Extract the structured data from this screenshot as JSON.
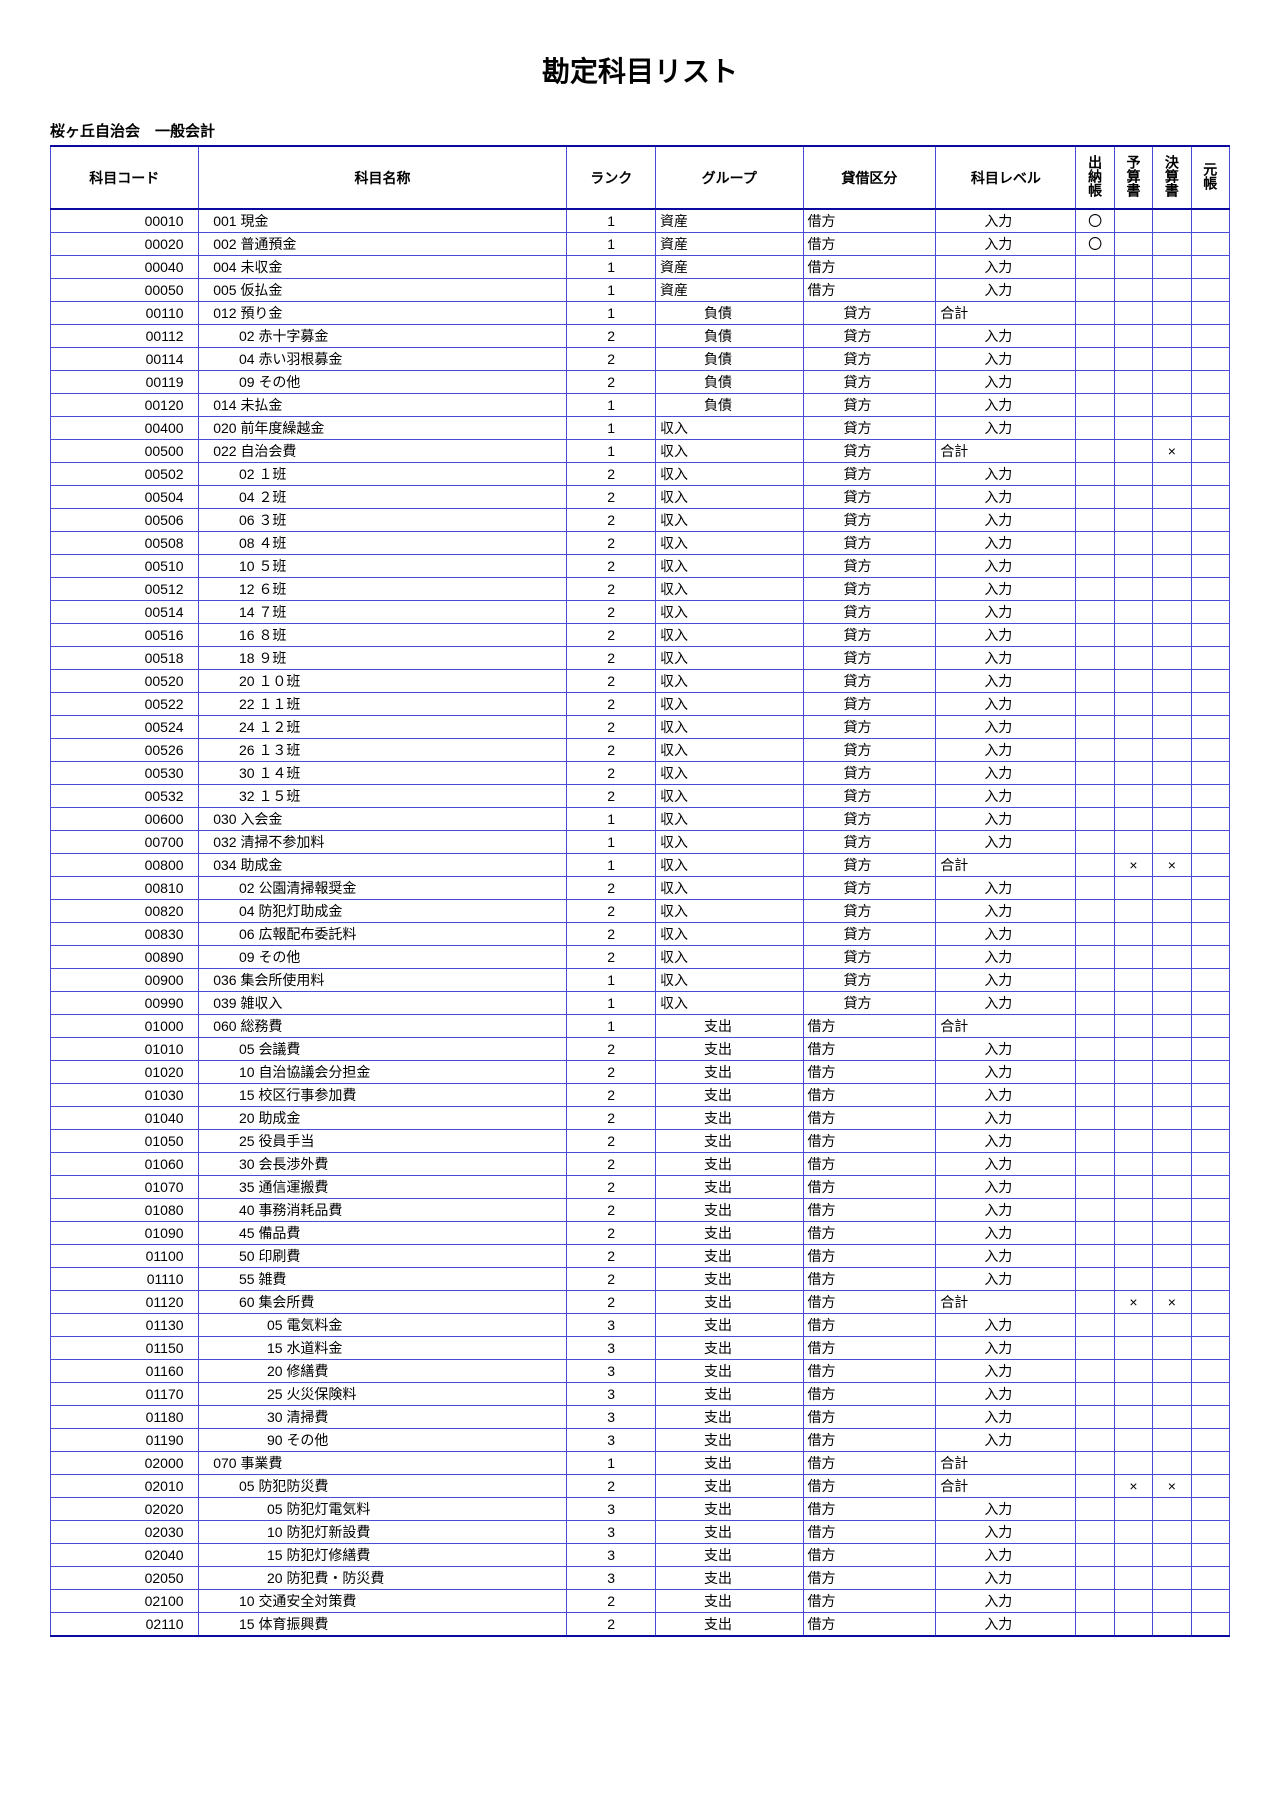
{
  "title": "勘定科目リスト",
  "org": "桜ヶ丘自治会　一般会計",
  "headers": {
    "code": "科目コード",
    "name": "科目名称",
    "rank": "ランク",
    "group": "グループ",
    "drcr": "貸借区分",
    "level": "科目レベル",
    "cashbook": "出納帳",
    "budget": "予算書",
    "settlement": "決算書",
    "ledger": "元帳"
  },
  "rows": [
    {
      "code": "00010",
      "num": "001",
      "name": "現金",
      "ind": 0,
      "rank": "1",
      "group": "資産",
      "galign": "l",
      "drcr": "借方",
      "level": "入力",
      "lalign": "r",
      "cb": "〇"
    },
    {
      "code": "00020",
      "num": "002",
      "name": "普通預金",
      "ind": 0,
      "rank": "1",
      "group": "資産",
      "galign": "l",
      "drcr": "借方",
      "level": "入力",
      "lalign": "r",
      "cb": "〇"
    },
    {
      "code": "00040",
      "num": "004",
      "name": "未収金",
      "ind": 0,
      "rank": "1",
      "group": "資産",
      "galign": "l",
      "drcr": "借方",
      "level": "入力",
      "lalign": "r"
    },
    {
      "code": "00050",
      "num": "005",
      "name": "仮払金",
      "ind": 0,
      "rank": "1",
      "group": "資産",
      "galign": "l",
      "drcr": "借方",
      "level": "入力",
      "lalign": "r"
    },
    {
      "code": "00110",
      "num": "012",
      "name": "預り金",
      "ind": 0,
      "rank": "1",
      "group": "負債",
      "galign": "r",
      "drcr": "貸方",
      "dalign": "r",
      "level": "合計",
      "lalign": "l"
    },
    {
      "code": "00112",
      "num": "02",
      "name": "赤十字募金",
      "ind": 1,
      "rank": "2",
      "group": "負債",
      "galign": "r",
      "drcr": "貸方",
      "dalign": "r",
      "level": "入力",
      "lalign": "r"
    },
    {
      "code": "00114",
      "num": "04",
      "name": "赤い羽根募金",
      "ind": 1,
      "rank": "2",
      "group": "負債",
      "galign": "r",
      "drcr": "貸方",
      "dalign": "r",
      "level": "入力",
      "lalign": "r"
    },
    {
      "code": "00119",
      "num": "09",
      "name": "その他",
      "ind": 1,
      "rank": "2",
      "group": "負債",
      "galign": "r",
      "drcr": "貸方",
      "dalign": "r",
      "level": "入力",
      "lalign": "r"
    },
    {
      "code": "00120",
      "num": "014",
      "name": "未払金",
      "ind": 0,
      "rank": "1",
      "group": "負債",
      "galign": "r",
      "drcr": "貸方",
      "dalign": "r",
      "level": "入力",
      "lalign": "r"
    },
    {
      "code": "00400",
      "num": "020",
      "name": "前年度繰越金",
      "ind": 0,
      "rank": "1",
      "group": "収入",
      "galign": "l",
      "drcr": "貸方",
      "dalign": "r",
      "level": "入力",
      "lalign": "r"
    },
    {
      "code": "00500",
      "num": "022",
      "name": "自治会費",
      "ind": 0,
      "rank": "1",
      "group": "収入",
      "galign": "l",
      "drcr": "貸方",
      "dalign": "r",
      "level": "合計",
      "lalign": "l",
      "st": "×"
    },
    {
      "code": "00502",
      "num": "02",
      "name": "１班",
      "ind": 1,
      "rank": "2",
      "group": "収入",
      "galign": "l",
      "drcr": "貸方",
      "dalign": "r",
      "level": "入力",
      "lalign": "r"
    },
    {
      "code": "00504",
      "num": "04",
      "name": "２班",
      "ind": 1,
      "rank": "2",
      "group": "収入",
      "galign": "l",
      "drcr": "貸方",
      "dalign": "r",
      "level": "入力",
      "lalign": "r"
    },
    {
      "code": "00506",
      "num": "06",
      "name": "３班",
      "ind": 1,
      "rank": "2",
      "group": "収入",
      "galign": "l",
      "drcr": "貸方",
      "dalign": "r",
      "level": "入力",
      "lalign": "r"
    },
    {
      "code": "00508",
      "num": "08",
      "name": "４班",
      "ind": 1,
      "rank": "2",
      "group": "収入",
      "galign": "l",
      "drcr": "貸方",
      "dalign": "r",
      "level": "入力",
      "lalign": "r"
    },
    {
      "code": "00510",
      "num": "10",
      "name": "５班",
      "ind": 1,
      "rank": "2",
      "group": "収入",
      "galign": "l",
      "drcr": "貸方",
      "dalign": "r",
      "level": "入力",
      "lalign": "r"
    },
    {
      "code": "00512",
      "num": "12",
      "name": "６班",
      "ind": 1,
      "rank": "2",
      "group": "収入",
      "galign": "l",
      "drcr": "貸方",
      "dalign": "r",
      "level": "入力",
      "lalign": "r"
    },
    {
      "code": "00514",
      "num": "14",
      "name": "７班",
      "ind": 1,
      "rank": "2",
      "group": "収入",
      "galign": "l",
      "drcr": "貸方",
      "dalign": "r",
      "level": "入力",
      "lalign": "r"
    },
    {
      "code": "00516",
      "num": "16",
      "name": "８班",
      "ind": 1,
      "rank": "2",
      "group": "収入",
      "galign": "l",
      "drcr": "貸方",
      "dalign": "r",
      "level": "入力",
      "lalign": "r"
    },
    {
      "code": "00518",
      "num": "18",
      "name": "９班",
      "ind": 1,
      "rank": "2",
      "group": "収入",
      "galign": "l",
      "drcr": "貸方",
      "dalign": "r",
      "level": "入力",
      "lalign": "r"
    },
    {
      "code": "00520",
      "num": "20",
      "name": "１０班",
      "ind": 1,
      "rank": "2",
      "group": "収入",
      "galign": "l",
      "drcr": "貸方",
      "dalign": "r",
      "level": "入力",
      "lalign": "r"
    },
    {
      "code": "00522",
      "num": "22",
      "name": "１１班",
      "ind": 1,
      "rank": "2",
      "group": "収入",
      "galign": "l",
      "drcr": "貸方",
      "dalign": "r",
      "level": "入力",
      "lalign": "r"
    },
    {
      "code": "00524",
      "num": "24",
      "name": "１２班",
      "ind": 1,
      "rank": "2",
      "group": "収入",
      "galign": "l",
      "drcr": "貸方",
      "dalign": "r",
      "level": "入力",
      "lalign": "r"
    },
    {
      "code": "00526",
      "num": "26",
      "name": "１３班",
      "ind": 1,
      "rank": "2",
      "group": "収入",
      "galign": "l",
      "drcr": "貸方",
      "dalign": "r",
      "level": "入力",
      "lalign": "r"
    },
    {
      "code": "00530",
      "num": "30",
      "name": "１４班",
      "ind": 1,
      "rank": "2",
      "group": "収入",
      "galign": "l",
      "drcr": "貸方",
      "dalign": "r",
      "level": "入力",
      "lalign": "r"
    },
    {
      "code": "00532",
      "num": "32",
      "name": "１５班",
      "ind": 1,
      "rank": "2",
      "group": "収入",
      "galign": "l",
      "drcr": "貸方",
      "dalign": "r",
      "level": "入力",
      "lalign": "r"
    },
    {
      "code": "00600",
      "num": "030",
      "name": "入会金",
      "ind": 0,
      "rank": "1",
      "group": "収入",
      "galign": "l",
      "drcr": "貸方",
      "dalign": "r",
      "level": "入力",
      "lalign": "r"
    },
    {
      "code": "00700",
      "num": "032",
      "name": "清掃不参加料",
      "ind": 0,
      "rank": "1",
      "group": "収入",
      "galign": "l",
      "drcr": "貸方",
      "dalign": "r",
      "level": "入力",
      "lalign": "r"
    },
    {
      "code": "00800",
      "num": "034",
      "name": "助成金",
      "ind": 0,
      "rank": "1",
      "group": "収入",
      "galign": "l",
      "drcr": "貸方",
      "dalign": "r",
      "level": "合計",
      "lalign": "l",
      "bd": "×",
      "st": "×"
    },
    {
      "code": "00810",
      "num": "02",
      "name": "公園清掃報奨金",
      "ind": 1,
      "rank": "2",
      "group": "収入",
      "galign": "l",
      "drcr": "貸方",
      "dalign": "r",
      "level": "入力",
      "lalign": "r"
    },
    {
      "code": "00820",
      "num": "04",
      "name": "防犯灯助成金",
      "ind": 1,
      "rank": "2",
      "group": "収入",
      "galign": "l",
      "drcr": "貸方",
      "dalign": "r",
      "level": "入力",
      "lalign": "r"
    },
    {
      "code": "00830",
      "num": "06",
      "name": "広報配布委託料",
      "ind": 1,
      "rank": "2",
      "group": "収入",
      "galign": "l",
      "drcr": "貸方",
      "dalign": "r",
      "level": "入力",
      "lalign": "r"
    },
    {
      "code": "00890",
      "num": "09",
      "name": "その他",
      "ind": 1,
      "rank": "2",
      "group": "収入",
      "galign": "l",
      "drcr": "貸方",
      "dalign": "r",
      "level": "入力",
      "lalign": "r"
    },
    {
      "code": "00900",
      "num": "036",
      "name": "集会所使用料",
      "ind": 0,
      "rank": "1",
      "group": "収入",
      "galign": "l",
      "drcr": "貸方",
      "dalign": "r",
      "level": "入力",
      "lalign": "r"
    },
    {
      "code": "00990",
      "num": "039",
      "name": "雑収入",
      "ind": 0,
      "rank": "1",
      "group": "収入",
      "galign": "l",
      "drcr": "貸方",
      "dalign": "r",
      "level": "入力",
      "lalign": "r"
    },
    {
      "code": "01000",
      "num": "060",
      "name": "総務費",
      "ind": 0,
      "rank": "1",
      "group": "支出",
      "galign": "r",
      "drcr": "借方",
      "level": "合計",
      "lalign": "l"
    },
    {
      "code": "01010",
      "num": "05",
      "name": "会議費",
      "ind": 1,
      "rank": "2",
      "group": "支出",
      "galign": "r",
      "drcr": "借方",
      "level": "入力",
      "lalign": "r"
    },
    {
      "code": "01020",
      "num": "10",
      "name": "自治協議会分担金",
      "ind": 1,
      "rank": "2",
      "group": "支出",
      "galign": "r",
      "drcr": "借方",
      "level": "入力",
      "lalign": "r"
    },
    {
      "code": "01030",
      "num": "15",
      "name": "校区行事参加費",
      "ind": 1,
      "rank": "2",
      "group": "支出",
      "galign": "r",
      "drcr": "借方",
      "level": "入力",
      "lalign": "r"
    },
    {
      "code": "01040",
      "num": "20",
      "name": "助成金",
      "ind": 1,
      "rank": "2",
      "group": "支出",
      "galign": "r",
      "drcr": "借方",
      "level": "入力",
      "lalign": "r"
    },
    {
      "code": "01050",
      "num": "25",
      "name": "役員手当",
      "ind": 1,
      "rank": "2",
      "group": "支出",
      "galign": "r",
      "drcr": "借方",
      "level": "入力",
      "lalign": "r"
    },
    {
      "code": "01060",
      "num": "30",
      "name": "会長渉外費",
      "ind": 1,
      "rank": "2",
      "group": "支出",
      "galign": "r",
      "drcr": "借方",
      "level": "入力",
      "lalign": "r"
    },
    {
      "code": "01070",
      "num": "35",
      "name": "通信運搬費",
      "ind": 1,
      "rank": "2",
      "group": "支出",
      "galign": "r",
      "drcr": "借方",
      "level": "入力",
      "lalign": "r"
    },
    {
      "code": "01080",
      "num": "40",
      "name": "事務消耗品費",
      "ind": 1,
      "rank": "2",
      "group": "支出",
      "galign": "r",
      "drcr": "借方",
      "level": "入力",
      "lalign": "r"
    },
    {
      "code": "01090",
      "num": "45",
      "name": "備品費",
      "ind": 1,
      "rank": "2",
      "group": "支出",
      "galign": "r",
      "drcr": "借方",
      "level": "入力",
      "lalign": "r"
    },
    {
      "code": "01100",
      "num": "50",
      "name": "印刷費",
      "ind": 1,
      "rank": "2",
      "group": "支出",
      "galign": "r",
      "drcr": "借方",
      "level": "入力",
      "lalign": "r"
    },
    {
      "code": "01110",
      "num": "55",
      "name": "雑費",
      "ind": 1,
      "rank": "2",
      "group": "支出",
      "galign": "r",
      "drcr": "借方",
      "level": "入力",
      "lalign": "r"
    },
    {
      "code": "01120",
      "num": "60",
      "name": "集会所費",
      "ind": 1,
      "rank": "2",
      "group": "支出",
      "galign": "r",
      "drcr": "借方",
      "level": "合計",
      "lalign": "l",
      "bd": "×",
      "st": "×"
    },
    {
      "code": "01130",
      "num": "05",
      "name": "電気料金",
      "ind": 2,
      "rank": "3",
      "group": "支出",
      "galign": "r",
      "drcr": "借方",
      "level": "入力",
      "lalign": "r"
    },
    {
      "code": "01150",
      "num": "15",
      "name": "水道料金",
      "ind": 2,
      "rank": "3",
      "group": "支出",
      "galign": "r",
      "drcr": "借方",
      "level": "入力",
      "lalign": "r"
    },
    {
      "code": "01160",
      "num": "20",
      "name": "修繕費",
      "ind": 2,
      "rank": "3",
      "group": "支出",
      "galign": "r",
      "drcr": "借方",
      "level": "入力",
      "lalign": "r"
    },
    {
      "code": "01170",
      "num": "25",
      "name": "火災保険料",
      "ind": 2,
      "rank": "3",
      "group": "支出",
      "galign": "r",
      "drcr": "借方",
      "level": "入力",
      "lalign": "r"
    },
    {
      "code": "01180",
      "num": "30",
      "name": "清掃費",
      "ind": 2,
      "rank": "3",
      "group": "支出",
      "galign": "r",
      "drcr": "借方",
      "level": "入力",
      "lalign": "r"
    },
    {
      "code": "01190",
      "num": "90",
      "name": "その他",
      "ind": 2,
      "rank": "3",
      "group": "支出",
      "galign": "r",
      "drcr": "借方",
      "level": "入力",
      "lalign": "r"
    },
    {
      "code": "02000",
      "num": "070",
      "name": "事業費",
      "ind": 0,
      "rank": "1",
      "group": "支出",
      "galign": "r",
      "drcr": "借方",
      "level": "合計",
      "lalign": "l"
    },
    {
      "code": "02010",
      "num": "05",
      "name": "防犯防災費",
      "ind": 1,
      "rank": "2",
      "group": "支出",
      "galign": "r",
      "drcr": "借方",
      "level": "合計",
      "lalign": "l",
      "bd": "×",
      "st": "×"
    },
    {
      "code": "02020",
      "num": "05",
      "name": "防犯灯電気料",
      "ind": 2,
      "rank": "3",
      "group": "支出",
      "galign": "r",
      "drcr": "借方",
      "level": "入力",
      "lalign": "r"
    },
    {
      "code": "02030",
      "num": "10",
      "name": "防犯灯新設費",
      "ind": 2,
      "rank": "3",
      "group": "支出",
      "galign": "r",
      "drcr": "借方",
      "level": "入力",
      "lalign": "r"
    },
    {
      "code": "02040",
      "num": "15",
      "name": "防犯灯修繕費",
      "ind": 2,
      "rank": "3",
      "group": "支出",
      "galign": "r",
      "drcr": "借方",
      "level": "入力",
      "lalign": "r"
    },
    {
      "code": "02050",
      "num": "20",
      "name": "防犯費・防災費",
      "ind": 2,
      "rank": "3",
      "group": "支出",
      "galign": "r",
      "drcr": "借方",
      "level": "入力",
      "lalign": "r"
    },
    {
      "code": "02100",
      "num": "10",
      "name": "交通安全対策費",
      "ind": 1,
      "rank": "2",
      "group": "支出",
      "galign": "r",
      "drcr": "借方",
      "level": "入力",
      "lalign": "r"
    },
    {
      "code": "02110",
      "num": "15",
      "name": "体育振興費",
      "ind": 1,
      "rank": "2",
      "group": "支出",
      "galign": "r",
      "drcr": "借方",
      "level": "入力",
      "lalign": "r"
    }
  ]
}
